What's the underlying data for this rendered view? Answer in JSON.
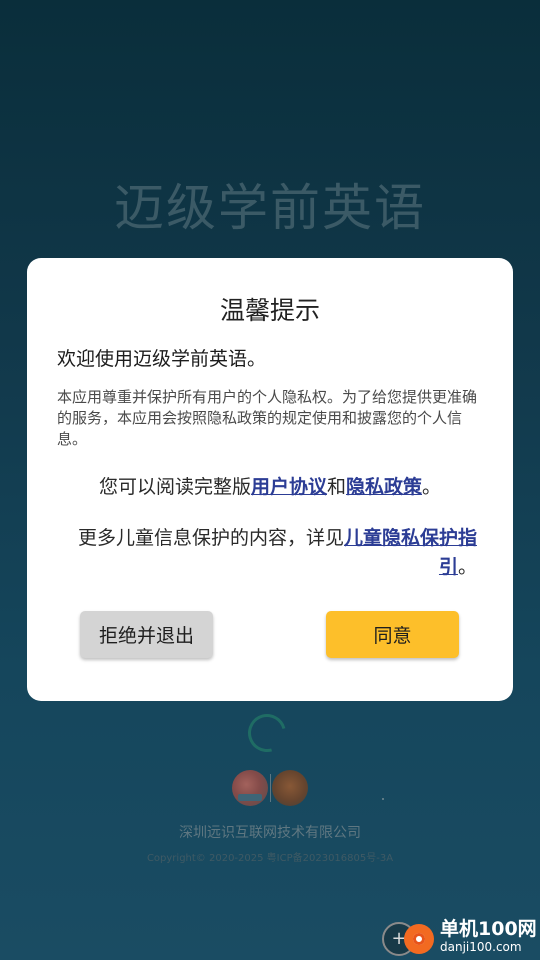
{
  "app": {
    "title": "迈级学前英语",
    "company": "深圳远识互联网技术有限公司",
    "copyright": "Copyright© 2020-2025 粤ICP备2023016805号-3A"
  },
  "dialog": {
    "title": "温馨提示",
    "welcome": "欢迎使用迈级学前英语。",
    "intro": "本应用尊重并保护所有用户的个人隐私权。为了给您提供更准确的服务，本应用会按照隐私政策的规定使用和披露您的个人信息。",
    "read_prefix": "您可以阅读完整版",
    "user_agreement": "用户协议",
    "and": "和",
    "privacy_policy": "隐私政策",
    "period": "。",
    "child_prefix": "更多儿童信息保护的内容，详见",
    "child_link": "儿童隐私保护指引",
    "child_period": "。",
    "reject_label": "拒绝并退出",
    "agree_label": "同意"
  },
  "watermark": {
    "name": "单机100网",
    "url": "danji100.com",
    "icon": "+"
  },
  "colors": {
    "background": "#11384a",
    "link": "#2c3d95",
    "agree_button": "#fdbf2a",
    "reject_button": "#d4d4d4"
  }
}
